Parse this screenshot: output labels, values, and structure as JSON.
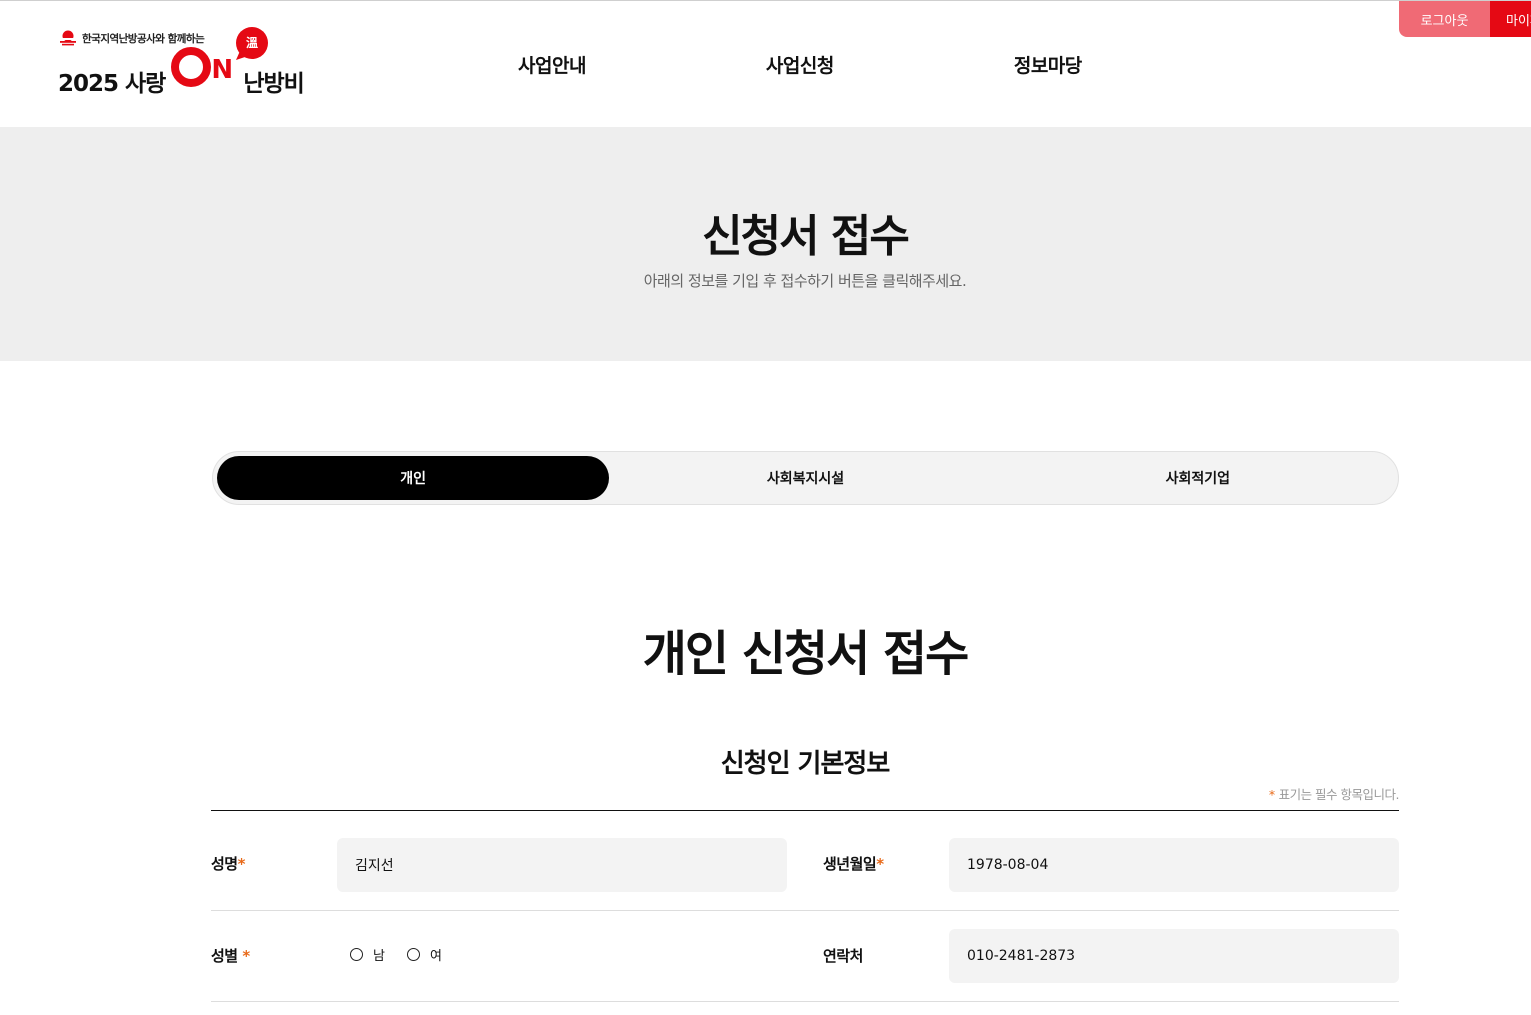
{
  "header": {
    "logo_sub": "한국지역난방공사와 함께하는",
    "logo_year_text": "2025 사랑",
    "logo_on": "N",
    "logo_bubble": "溫",
    "logo_tail": "난방비",
    "nav": [
      "사업안내",
      "사업신청",
      "정보마당"
    ],
    "logout_label": "로그아웃",
    "mypage_label": "마이페이지"
  },
  "hero": {
    "title": "신청서 접수",
    "description": "아래의 정보를 기입 후 접수하기 버튼을 클릭해주세요."
  },
  "tabs": {
    "items": [
      "개인",
      "사회복지시설",
      "사회적기업"
    ],
    "active": "개인"
  },
  "section": {
    "title": "개인 신청서 접수",
    "subtitle": "신청인 기본정보",
    "required_note": "표기는 필수 항목입니다.",
    "required_mark": "*"
  },
  "form": {
    "name_label": "성명",
    "name_value": "김지선",
    "birth_label": "생년월일",
    "birth_value": "1978-08-04",
    "gender_label": "성별",
    "gender_options": [
      "남",
      "여"
    ],
    "contact_label": "연락처",
    "contact_value": "010-2481-2873"
  },
  "colors": {
    "brand_red": "#e50914",
    "logout_pink": "#f06a75",
    "required_orange": "#e86a1a",
    "hero_bg": "#eeeeee"
  }
}
